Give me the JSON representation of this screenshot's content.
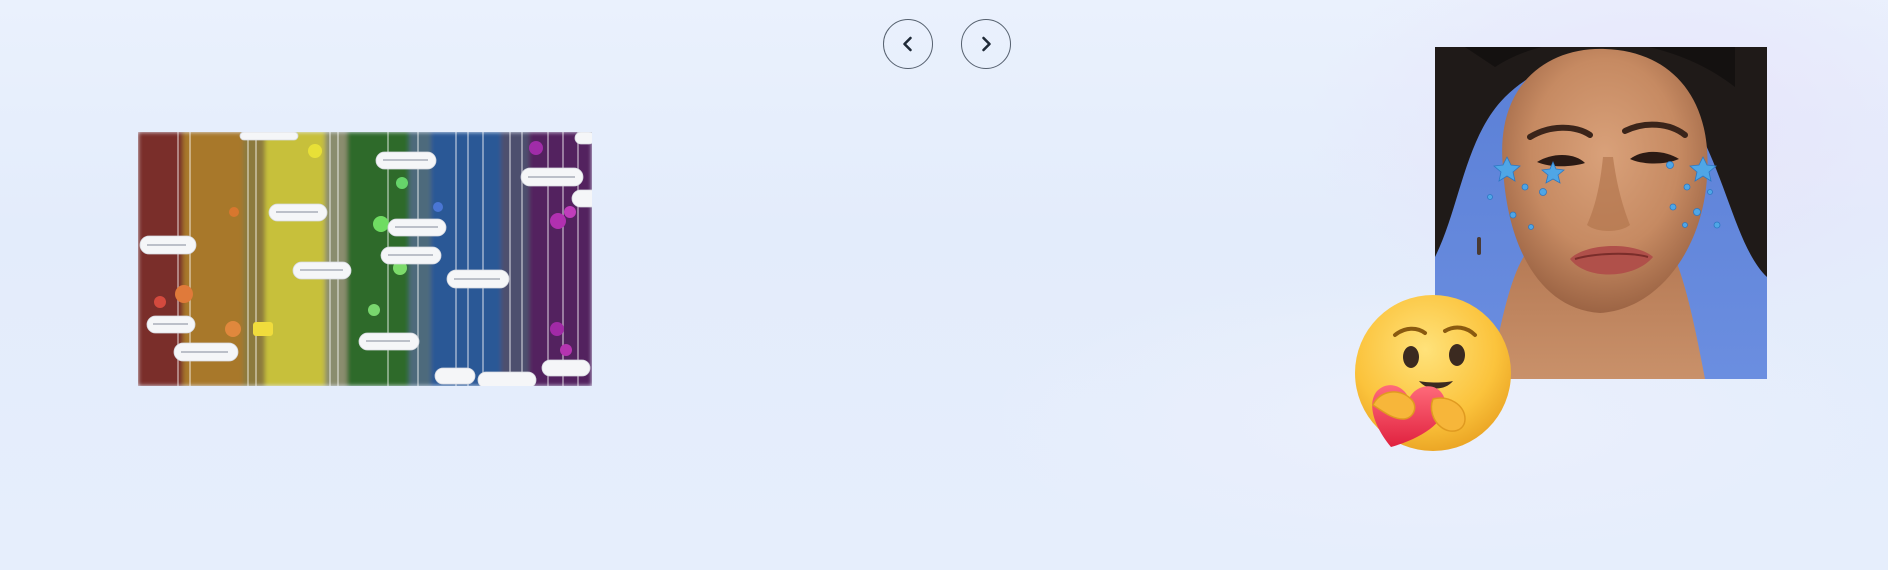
{
  "carousel": {
    "prev_label": "Previous",
    "next_label": "Next",
    "prev_icon": "chevron-left-icon",
    "next_icon": "chevron-right-icon"
  },
  "media": {
    "left_image": "rainbow-comment-stream-image",
    "right_image": "portrait-with-star-stickers-image",
    "sticker": "care-emoji-icon"
  },
  "colors": {
    "background": "#e5edfc",
    "button_border": "#55606e",
    "icon": "#1f2a37"
  }
}
